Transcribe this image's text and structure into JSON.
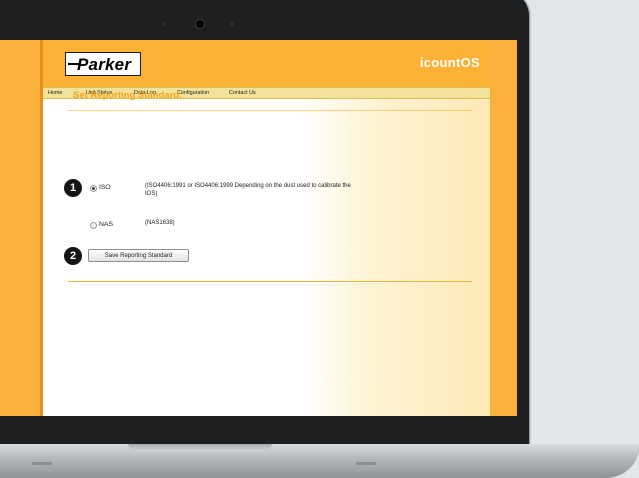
{
  "app": {
    "logo_text": "Parker",
    "title": "icountOS"
  },
  "nav": {
    "items": [
      {
        "label": "Home"
      },
      {
        "label": "Unit Status"
      },
      {
        "label": "Data Log"
      },
      {
        "label": "Configuration"
      },
      {
        "label": "Contact Us"
      }
    ]
  },
  "page": {
    "title": "Set Reporting Standard:",
    "options": [
      {
        "badge": "1",
        "label": "ISO",
        "selected": true,
        "description": "(ISO4406:1991 or ISO4406:1999 Depending on the dust used to calibrate the IOS)"
      },
      {
        "label": "NAS",
        "selected": false,
        "description": "(NAS1638)"
      }
    ],
    "save": {
      "badge": "2",
      "label": "Save Reporting Standard"
    }
  },
  "colors": {
    "brand_orange": "#fbb03b",
    "title_orange": "#f6a21a",
    "nav_bar": "#f3e29a"
  }
}
